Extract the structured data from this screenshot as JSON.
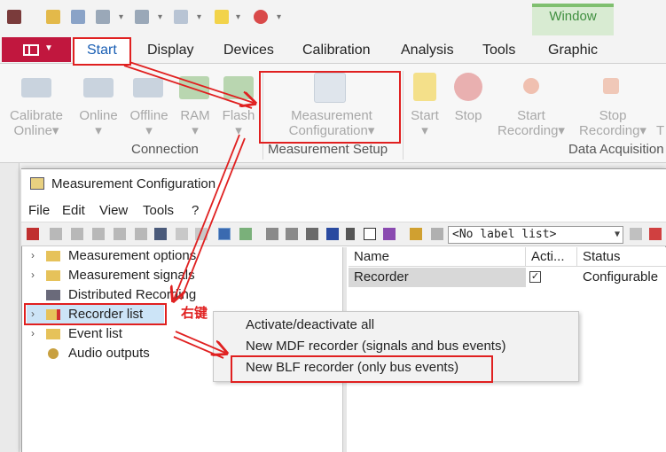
{
  "ribbon": {
    "context_tab": "Window",
    "tabs": [
      "Start",
      "Display",
      "Devices",
      "Calibration",
      "Analysis",
      "Tools",
      "Graphic"
    ],
    "buttons": {
      "calibrate_online": [
        "Calibrate",
        "Online"
      ],
      "online": "Online",
      "offline": "Offline",
      "ram": "RAM",
      "flash": "Flash",
      "measurement_configuration": [
        "Measurement",
        "Configuration"
      ],
      "start": "Start",
      "stop": "Stop",
      "start_recording": [
        "Start",
        "Recording"
      ],
      "stop_recording": [
        "Stop",
        "Recording"
      ],
      "truncated": "T"
    },
    "groups": {
      "connection": "Connection",
      "measurement_setup": "Measurement Setup",
      "data_acquisition": "Data Acquisition"
    },
    "dropdown_glyph": "▾"
  },
  "dialog": {
    "title": "Measurement Configuration",
    "menu": [
      "File",
      "Edit",
      "View",
      "Tools",
      "?"
    ],
    "label_list": "<No label list>"
  },
  "tree": {
    "items": [
      {
        "label": "Measurement options",
        "expandable": true
      },
      {
        "label": "Measurement signals",
        "expandable": true
      },
      {
        "label": "Distributed Recording",
        "expandable": false
      },
      {
        "label": "Recorder list",
        "expandable": true
      },
      {
        "label": "Event list",
        "expandable": true
      },
      {
        "label": "Audio outputs",
        "expandable": false
      }
    ]
  },
  "grid": {
    "headers": [
      "Name",
      "Acti...",
      "Status"
    ],
    "rows": [
      {
        "name": "Recorder",
        "active": true,
        "status": "Configurable"
      }
    ]
  },
  "context_menu": {
    "items": [
      "Activate/deactivate all",
      "New MDF recorder (signals and bus events)",
      "New BLF recorder (only bus events)"
    ]
  },
  "annotation": {
    "right_click": "右键",
    "color": "#e02020"
  },
  "colors": {
    "file_button": "#c1173e",
    "context_tab": "#d8ebd2",
    "selection": "#cce4f7"
  }
}
